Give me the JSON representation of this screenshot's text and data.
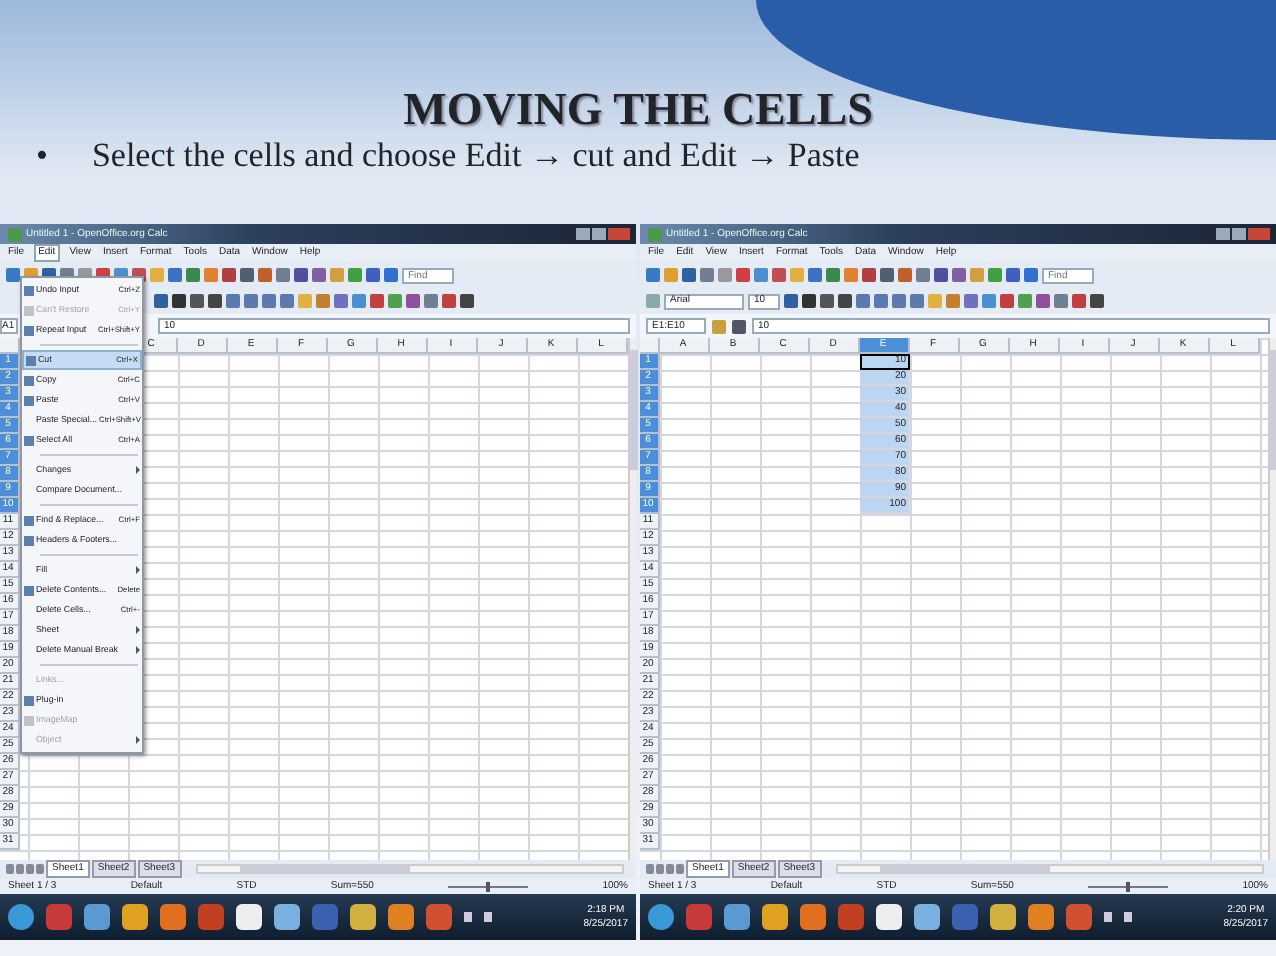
{
  "slide": {
    "title": "MOVING THE CELLS",
    "bullet": "•",
    "text": "Select the cells and choose Edit → cut and Edit → Paste"
  },
  "windows": [
    {
      "title": "Untitled 1 - OpenOffice.org Calc",
      "menu": [
        {
          "label": "File",
          "selected": false
        },
        {
          "label": "Edit",
          "selected": true
        },
        {
          "label": "View",
          "selected": false
        },
        {
          "label": "Insert",
          "selected": false
        },
        {
          "label": "Format",
          "selected": false
        },
        {
          "label": "Tools",
          "selected": false
        },
        {
          "label": "Data",
          "selected": false
        },
        {
          "label": "Window",
          "selected": false
        },
        {
          "label": "Help",
          "selected": false
        }
      ],
      "find_placeholder": "Find",
      "name_box": "A1",
      "formula": "10",
      "columns": [
        {
          "label": "C",
          "selected": false
        },
        {
          "label": "D",
          "selected": false
        },
        {
          "label": "E",
          "selected": false
        },
        {
          "label": "F",
          "selected": false
        },
        {
          "label": "G",
          "selected": false
        },
        {
          "label": "H",
          "selected": false
        },
        {
          "label": "I",
          "selected": false
        },
        {
          "label": "J",
          "selected": false
        },
        {
          "label": "K",
          "selected": false
        },
        {
          "label": "L",
          "selected": false
        }
      ],
      "rows_selected": [
        true,
        true,
        true,
        true,
        true,
        true,
        true,
        true,
        true,
        true,
        false,
        false,
        false,
        false,
        false,
        false,
        false,
        false,
        false,
        false,
        false,
        false,
        false,
        false,
        false,
        false,
        false,
        false,
        false,
        false,
        false
      ],
      "row_labels": [
        "1",
        "2",
        "3",
        "4",
        "5",
        "6",
        "7",
        "8",
        "9",
        "10",
        "11",
        "12",
        "13",
        "14",
        "15",
        "16",
        "17",
        "18",
        "19",
        "20",
        "21",
        "22",
        "23",
        "24",
        "25",
        "26",
        "27",
        "28",
        "29",
        "30",
        "31"
      ],
      "edit_menu": [
        {
          "kind": "item",
          "label": "Undo Input",
          "shortcut": "Ctrl+Z",
          "icon": true,
          "disabled": false,
          "selected": false
        },
        {
          "kind": "item",
          "label": "Can't Restore",
          "shortcut": "Ctrl+Y",
          "icon": true,
          "disabled": true,
          "selected": false
        },
        {
          "kind": "item",
          "label": "Repeat Input",
          "shortcut": "Ctrl+Shift+Y",
          "icon": true,
          "disabled": false,
          "selected": false
        },
        {
          "kind": "separator"
        },
        {
          "kind": "item",
          "label": "Cut",
          "shortcut": "Ctrl+X",
          "icon": true,
          "disabled": false,
          "selected": true
        },
        {
          "kind": "item",
          "label": "Copy",
          "shortcut": "Ctrl+C",
          "icon": true,
          "disabled": false,
          "selected": false
        },
        {
          "kind": "item",
          "label": "Paste",
          "shortcut": "Ctrl+V",
          "icon": true,
          "disabled": false,
          "selected": false
        },
        {
          "kind": "item",
          "label": "Paste Special...",
          "shortcut": "Ctrl+Shift+V",
          "icon": false,
          "disabled": false,
          "selected": false
        },
        {
          "kind": "item",
          "label": "Select All",
          "shortcut": "Ctrl+A",
          "icon": true,
          "disabled": false,
          "selected": false
        },
        {
          "kind": "separator"
        },
        {
          "kind": "submenu",
          "label": "Changes",
          "icon": false,
          "disabled": false,
          "selected": false
        },
        {
          "kind": "item",
          "label": "Compare Document...",
          "icon": false,
          "disabled": false,
          "selected": false
        },
        {
          "kind": "separator"
        },
        {
          "kind": "item",
          "label": "Find & Replace...",
          "shortcut": "Ctrl+F",
          "icon": true,
          "disabled": false,
          "selected": false
        },
        {
          "kind": "item",
          "label": "Headers & Footers...",
          "icon": true,
          "disabled": false,
          "selected": false
        },
        {
          "kind": "separator"
        },
        {
          "kind": "submenu",
          "label": "Fill",
          "icon": false,
          "disabled": false,
          "selected": false
        },
        {
          "kind": "item",
          "label": "Delete Contents...",
          "shortcut": "Delete",
          "icon": true,
          "disabled": false,
          "selected": false
        },
        {
          "kind": "item",
          "label": "Delete Cells...",
          "shortcut": "Ctrl+-",
          "icon": false,
          "disabled": false,
          "selected": false
        },
        {
          "kind": "submenu",
          "label": "Sheet",
          "icon": false,
          "disabled": false,
          "selected": false
        },
        {
          "kind": "submenu",
          "label": "Delete Manual Break",
          "icon": false,
          "disabled": false,
          "selected": false
        },
        {
          "kind": "separator"
        },
        {
          "kind": "item",
          "label": "Links...",
          "icon": false,
          "disabled": true,
          "selected": false
        },
        {
          "kind": "item",
          "label": "Plug-in",
          "icon": true,
          "disabled": false,
          "selected": false
        },
        {
          "kind": "item",
          "label": "ImageMap",
          "icon": true,
          "disabled": true,
          "selected": false
        },
        {
          "kind": "submenu",
          "label": "Object",
          "icon": false,
          "disabled": true,
          "selected": false
        }
      ],
      "sheet_tabs": [
        {
          "label": "Sheet1",
          "selected": true
        },
        {
          "label": "Sheet2",
          "selected": false
        },
        {
          "label": "Sheet3",
          "selected": false
        }
      ],
      "status": [
        "Sheet 1 / 3",
        "Default",
        "STD",
        "Sum=550",
        "100%"
      ],
      "zoom": {
        "level": 0.5
      },
      "clock": {
        "time": "2:18 PM",
        "date": "8/25/2017"
      }
    },
    {
      "title": "Untitled 1 - OpenOffice.org Calc",
      "menu": [
        {
          "label": "File",
          "selected": false
        },
        {
          "label": "Edit",
          "selected": false
        },
        {
          "label": "View",
          "selected": false
        },
        {
          "label": "Insert",
          "selected": false
        },
        {
          "label": "Format",
          "selected": false
        },
        {
          "label": "Tools",
          "selected": false
        },
        {
          "label": "Data",
          "selected": false
        },
        {
          "label": "Window",
          "selected": false
        },
        {
          "label": "Help",
          "selected": false
        }
      ],
      "find_placeholder": "Find",
      "font_name": "Arial",
      "font_size": "10",
      "name_box": "E1:E10",
      "formula": "10",
      "columns": [
        {
          "label": "A",
          "selected": false
        },
        {
          "label": "B",
          "selected": false
        },
        {
          "label": "C",
          "selected": false
        },
        {
          "label": "D",
          "selected": false
        },
        {
          "label": "E",
          "selected": true,
          "cells": [
            "10",
            "20",
            "30",
            "40",
            "50",
            "60",
            "70",
            "80",
            "90",
            "100"
          ]
        },
        {
          "label": "F",
          "selected": false
        },
        {
          "label": "G",
          "selected": false
        },
        {
          "label": "H",
          "selected": false
        },
        {
          "label": "I",
          "selected": false
        },
        {
          "label": "J",
          "selected": false
        },
        {
          "label": "K",
          "selected": false
        },
        {
          "label": "L",
          "selected": false
        }
      ],
      "rows_selected": [
        true,
        true,
        true,
        true,
        true,
        true,
        true,
        true,
        true,
        true,
        false,
        false,
        false,
        false,
        false,
        false,
        false,
        false,
        false,
        false,
        false,
        false,
        false,
        false,
        false,
        false,
        false,
        false,
        false,
        false,
        false
      ],
      "row_labels": [
        "1",
        "2",
        "3",
        "4",
        "5",
        "6",
        "7",
        "8",
        "9",
        "10",
        "11",
        "12",
        "13",
        "14",
        "15",
        "16",
        "17",
        "18",
        "19",
        "20",
        "21",
        "22",
        "23",
        "24",
        "25",
        "26",
        "27",
        "28",
        "29",
        "30",
        "31"
      ],
      "sheet_tabs": [
        {
          "label": "Sheet1",
          "selected": true
        },
        {
          "label": "Sheet2",
          "selected": false
        },
        {
          "label": "Sheet3",
          "selected": false
        }
      ],
      "status": [
        "Sheet 1 / 3",
        "Default",
        "STD",
        "Sum=550",
        "100%"
      ],
      "zoom": {
        "level": 0.5
      },
      "clock": {
        "time": "2:20 PM",
        "date": "8/25/2017"
      }
    }
  ]
}
